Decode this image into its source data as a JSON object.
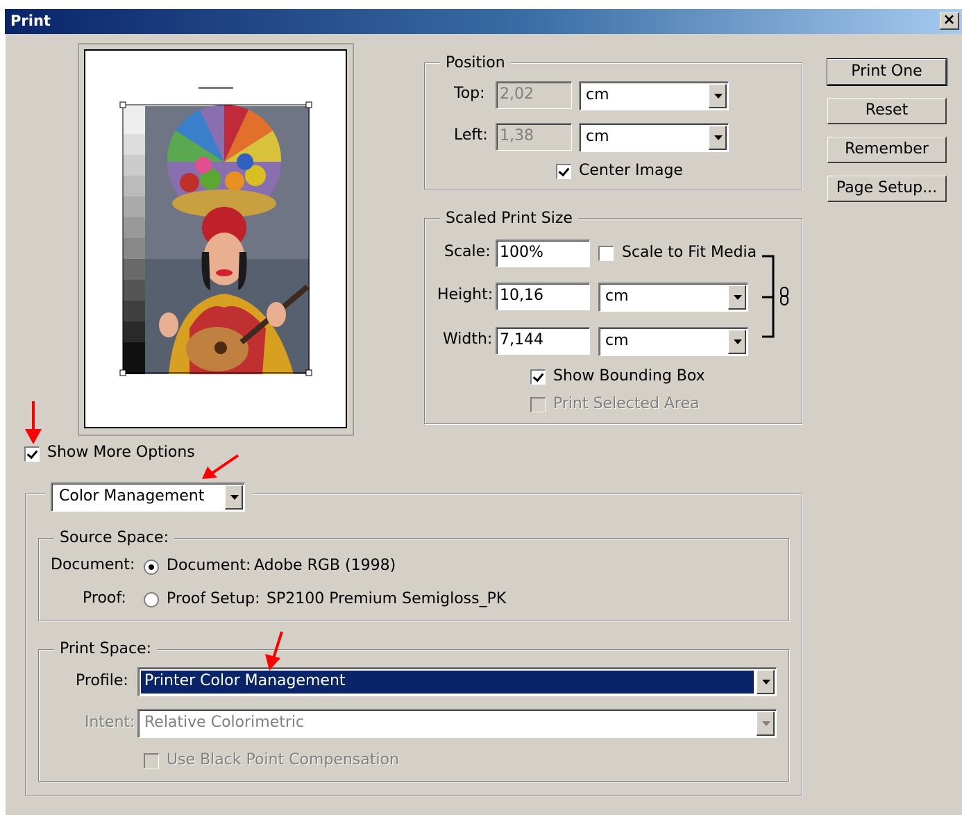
{
  "window": {
    "title": "Print",
    "close_label": "×"
  },
  "position": {
    "legend": "Position",
    "top_label": "Top:",
    "top_value": "2,02",
    "top_unit": "cm",
    "left_label": "Left:",
    "left_value": "1,38",
    "left_unit": "cm",
    "center_image_label": "Center Image",
    "center_image_checked": true
  },
  "scaled": {
    "legend": "Scaled Print Size",
    "scale_label": "Scale:",
    "scale_value": "100%",
    "scale_to_fit_label": "Scale to Fit Media",
    "height_label": "Height:",
    "height_value": "10,16",
    "height_unit": "cm",
    "width_label": "Width:",
    "width_value": "7,144",
    "width_unit": "cm",
    "show_bounding_box_label": "Show Bounding Box",
    "print_selected_area_label": "Print Selected Area"
  },
  "buttons": {
    "print_one": "Print One",
    "reset": "Reset",
    "remember": "Remember",
    "page_setup": "Page Setup..."
  },
  "more_options": {
    "label": "Show More Options",
    "checked": true,
    "section_select": "Color Management"
  },
  "source": {
    "legend": "Source Space:",
    "document_label": "Document:",
    "document_radio": "Document:",
    "document_profile": "Adobe RGB (1998)",
    "proof_label": "Proof:",
    "proof_radio": "Proof Setup:",
    "proof_profile": "SP2100 Premium Semigloss_PK"
  },
  "print_space": {
    "legend": "Print Space:",
    "profile_label": "Profile:",
    "profile_value": "Printer Color Management",
    "intent_label": "Intent:",
    "intent_value": "Relative Colorimetric",
    "bpc_label": "Use Black Point Compensation"
  },
  "colors": {
    "dialog_bg": "#d4d0c8",
    "title_gradient_start": "#0a246a",
    "title_gradient_end": "#a6caf0",
    "selection": "#0a246a",
    "annotation_arrow": "#ff0000"
  }
}
